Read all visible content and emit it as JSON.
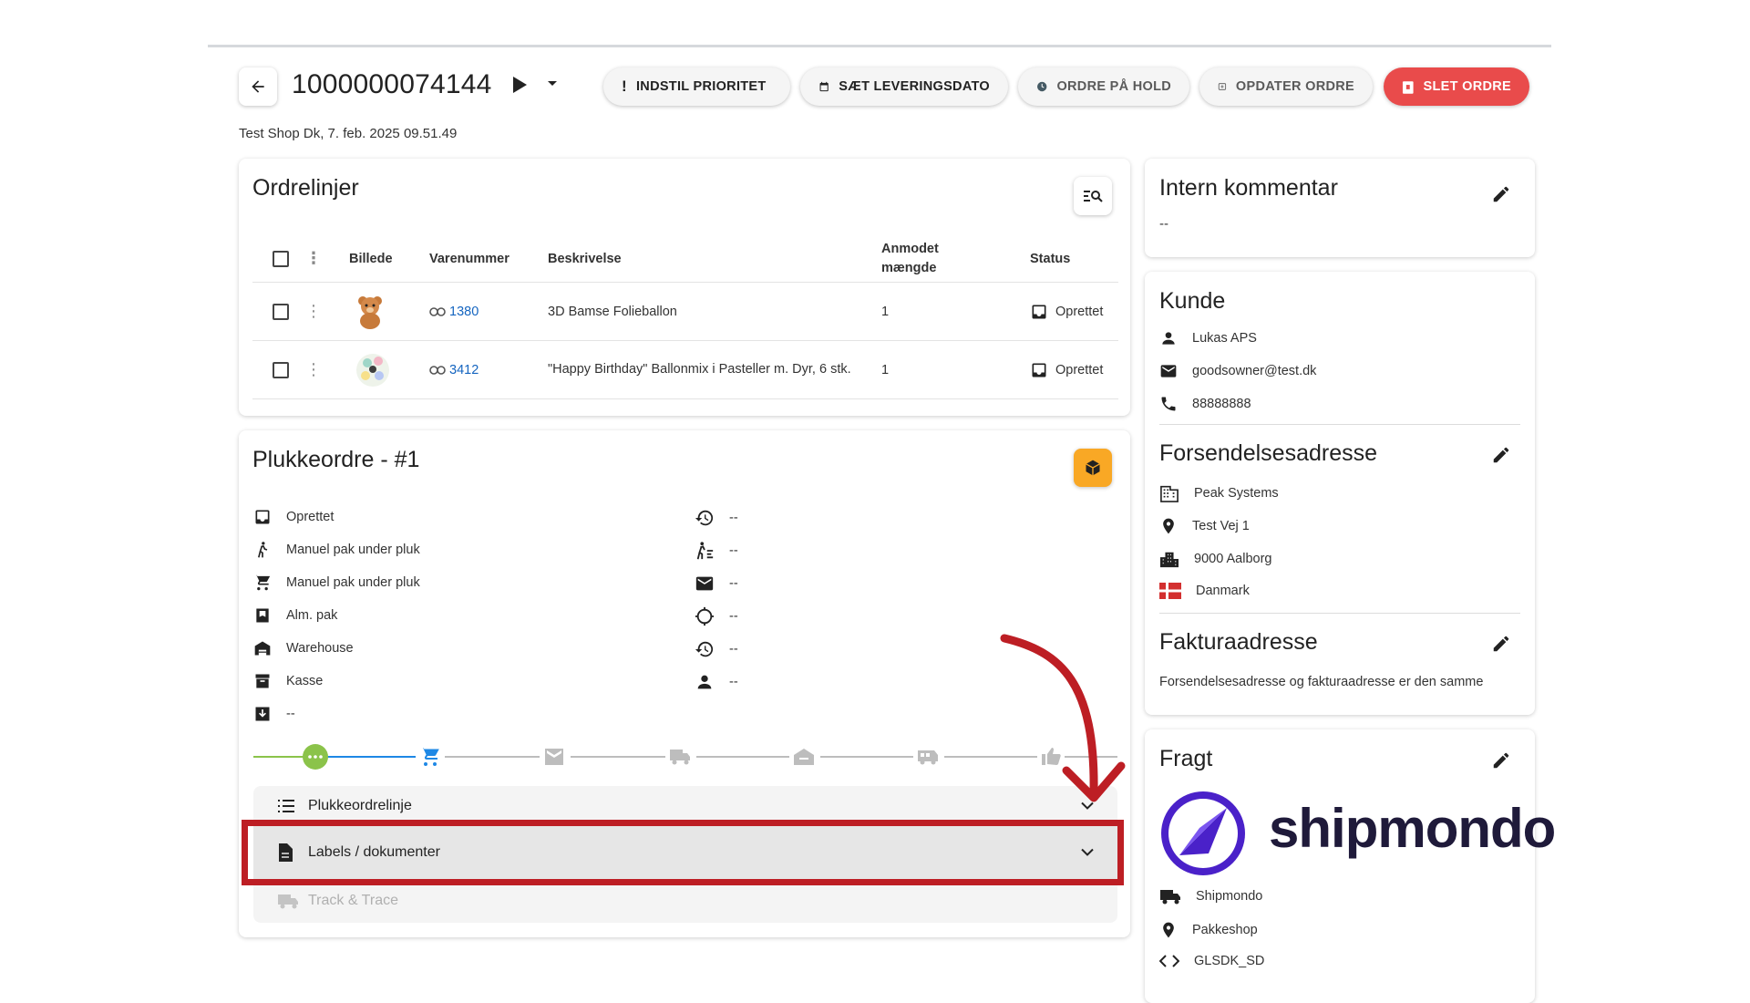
{
  "header": {
    "order_number": "1000000074144",
    "subinfo": "Test Shop Dk, 7. feb. 2025 09.51.49",
    "buttons": {
      "priority": "INDSTIL PRIORITET",
      "delivery_date": "SÆT LEVERINGSDATO",
      "hold": "ORDRE PÅ HOLD",
      "update": "OPDATER ORDRE",
      "delete": "SLET ORDRE"
    }
  },
  "order_lines": {
    "title": "Ordrelinjer",
    "columns": {
      "image": "Billede",
      "sku": "Varenummer",
      "description": "Beskrivelse",
      "qty_line1": "Anmodet",
      "qty_line2": "mængde",
      "status": "Status"
    },
    "rows": [
      {
        "sku": "1380",
        "description": "3D Bamse Folieballon",
        "qty": "1",
        "status": "Oprettet"
      },
      {
        "sku": "3412",
        "description": "\"Happy Birthday\" Ballonmix i Pasteller m. Dyr, 6 stk.",
        "qty": "1",
        "status": "Oprettet"
      }
    ]
  },
  "pick_order": {
    "title": "Plukkeordre - #1",
    "left": [
      "Oprettet",
      "Manuel pak under pluk",
      "Manuel pak under pluk",
      "Alm. pak",
      "Warehouse",
      "Kasse",
      "--"
    ],
    "right": [
      "--",
      "--",
      "--",
      "--",
      "--",
      "--"
    ],
    "accordions": {
      "lines": "Plukkeordrelinje",
      "labels": "Labels / dokumenter",
      "track": "Track & Trace"
    }
  },
  "internal_comment": {
    "title": "Intern kommentar",
    "value": "--"
  },
  "customer": {
    "title": "Kunde",
    "name": "Lukas APS",
    "email": "goodsowner@test.dk",
    "phone": "88888888"
  },
  "shipping_address": {
    "title": "Forsendelsesadresse",
    "company": "Peak Systems",
    "street": "Test Vej 1",
    "city": "9000 Aalborg",
    "country": "Danmark"
  },
  "billing_address": {
    "title": "Fakturaadresse",
    "note": "Forsendelsesadresse og fakturaadresse er den samme"
  },
  "freight": {
    "title": "Fragt",
    "logo_text": "shipmondo",
    "carrier": "Shipmondo",
    "service": "Pakkeshop",
    "code": "GLSDK_SD"
  },
  "colors": {
    "accent_green": "#8bc34a",
    "accent_blue": "#1e88e5",
    "danger": "#e94b4b",
    "highlight": "#bd1e24",
    "shipmondo_purple": "#4a21c9"
  }
}
